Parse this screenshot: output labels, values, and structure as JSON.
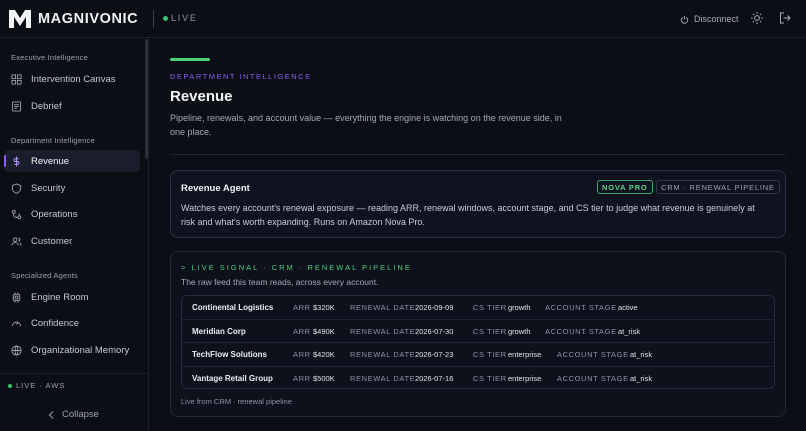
{
  "header": {
    "brand": "MAGNIVONIC",
    "live_label": "LIVE",
    "disconnect_label": "Disconnect"
  },
  "sidebar": {
    "sections": [
      {
        "title": "Executive Intelligence",
        "items": [
          {
            "label": "Intervention Canvas",
            "icon": "grid-icon"
          },
          {
            "label": "Debrief",
            "icon": "document-icon"
          }
        ]
      },
      {
        "title": "Department Intelligence",
        "items": [
          {
            "label": "Revenue",
            "icon": "dollar-icon",
            "active": true
          },
          {
            "label": "Security",
            "icon": "shield-icon"
          },
          {
            "label": "Operations",
            "icon": "workflow-icon"
          },
          {
            "label": "Customer",
            "icon": "users-icon"
          }
        ]
      },
      {
        "title": "Specialized Agents",
        "items": [
          {
            "label": "Engine Room",
            "icon": "cpu-icon"
          },
          {
            "label": "Confidence",
            "icon": "gauge-icon"
          },
          {
            "label": "Organizational Memory",
            "icon": "memory-icon"
          }
        ]
      }
    ],
    "env_label": "LIVE · AWS",
    "collapse_label": "Collapse"
  },
  "main": {
    "eyebrow": "DEPARTMENT INTELLIGENCE",
    "title": "Revenue",
    "description": "Pipeline, renewals, and account value — everything the engine is watching on the revenue side, in one place.",
    "agent": {
      "title": "Revenue Agent",
      "badge_model": "NOVA PRO",
      "badge_feed": "CRM · RENEWAL PIPELINE",
      "description": "Watches every account's renewal exposure — reading ARR, renewal windows, account stage, and CS tier to judge what revenue is genuinely at risk and what's worth expanding. Runs on Amazon Nova Pro."
    },
    "signal": {
      "heading": "> LIVE SIGNAL · CRM · RENEWAL PIPELINE",
      "subtitle": "The raw feed this team reads, across every account.",
      "labels": {
        "arr": "ARR",
        "renewal": "RENEWAL DATE",
        "tier": "CS TIER",
        "stage": "ACCOUNT STAGE"
      },
      "rows": [
        {
          "account": "Continental Logistics",
          "arr": "$320K",
          "renewal": "2026-09-09",
          "tier": "growth",
          "stage": "active"
        },
        {
          "account": "Meridian Corp",
          "arr": "$490K",
          "renewal": "2026-07-30",
          "tier": "growth",
          "stage": "at_risk"
        },
        {
          "account": "TechFlow Solutions",
          "arr": "$420K",
          "renewal": "2026-07-23",
          "tier": "enterprise",
          "stage": "at_risk"
        },
        {
          "account": "Vantage Retail Group",
          "arr": "$500K",
          "renewal": "2026-07-16",
          "tier": "enterprise",
          "stage": "at_risk"
        }
      ],
      "footer": "Live from CRM · renewal pipeline"
    }
  },
  "colors": {
    "accent_purple": "#8b5cf6",
    "live_green": "#4bd07a",
    "background": "#0b0e15"
  }
}
